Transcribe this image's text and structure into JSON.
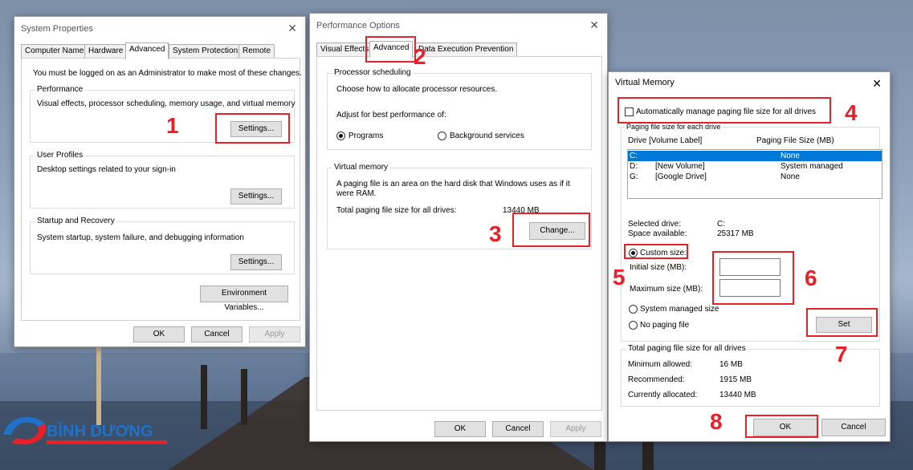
{
  "sysprops": {
    "title": "System Properties",
    "tabs": [
      "Computer Name",
      "Hardware",
      "Advanced",
      "System Protection",
      "Remote"
    ],
    "admin_note": "You must be logged on as an Administrator to make most of these changes.",
    "performance": {
      "title": "Performance",
      "desc": "Visual effects, processor scheduling, memory usage, and virtual memory",
      "settings": "Settings..."
    },
    "profiles": {
      "title": "User Profiles",
      "desc": "Desktop settings related to your sign-in",
      "settings": "Settings..."
    },
    "startup": {
      "title": "Startup and Recovery",
      "desc": "System startup, system failure, and debugging information",
      "settings": "Settings..."
    },
    "env_vars": "Environment Variables...",
    "ok": "OK",
    "cancel": "Cancel",
    "apply": "Apply"
  },
  "perfopts": {
    "title": "Performance Options",
    "tabs": [
      "Visual Effects",
      "Advanced",
      "Data Execution Prevention"
    ],
    "sched": {
      "title": "Processor scheduling",
      "desc": "Choose how to allocate processor resources.",
      "adjust": "Adjust for best performance of:",
      "programs": "Programs",
      "background": "Background services"
    },
    "vm": {
      "title": "Virtual memory",
      "desc1": "A paging file is an area on the hard disk that Windows uses as if it",
      "desc2": "were RAM.",
      "total_label": "Total paging file size for all drives:",
      "total_value": "13440 MB",
      "change": "Change..."
    },
    "ok": "OK",
    "cancel": "Cancel",
    "apply": "Apply"
  },
  "vmem": {
    "title": "Virtual Memory",
    "auto_manage": "Automatically manage paging file size for all drives",
    "group_title": "Paging file size for each drive",
    "col_drive": "Drive  [Volume Label]",
    "col_size": "Paging File Size (MB)",
    "drives": [
      {
        "drive": "C:",
        "label": "",
        "size": "None"
      },
      {
        "drive": "D:",
        "label": "[New Volume]",
        "size": "System managed"
      },
      {
        "drive": "G:",
        "label": "[Google Drive]",
        "size": "None"
      }
    ],
    "selected_label": "Selected drive:",
    "selected_value": "C:",
    "space_label": "Space available:",
    "space_value": "25317 MB",
    "custom": "Custom size:",
    "initial": "Initial size (MB):",
    "maximum": "Maximum size (MB):",
    "system_managed": "System managed size",
    "no_paging": "No paging file",
    "set": "Set",
    "total_title": "Total paging file size for all drives",
    "min_label": "Minimum allowed:",
    "min_value": "16 MB",
    "rec_label": "Recommended:",
    "rec_value": "1915 MB",
    "cur_label": "Currently allocated:",
    "cur_value": "13440 MB",
    "ok": "OK",
    "cancel": "Cancel"
  },
  "steps": [
    "1",
    "2",
    "3",
    "4",
    "5",
    "6",
    "7",
    "8"
  ],
  "logo": {
    "line1": "BÌNH DƯƠNG"
  },
  "colors": {
    "highlight": "#e8202a",
    "selection": "#0078d7"
  }
}
